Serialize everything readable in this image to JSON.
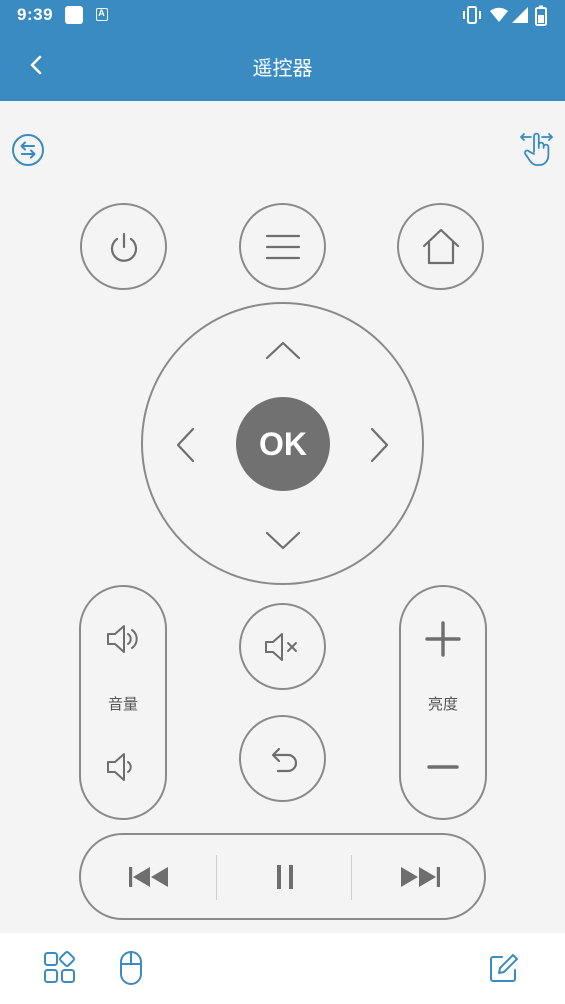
{
  "status_bar": {
    "time": "9:39",
    "notif_icon_letter": "A"
  },
  "app_bar": {
    "title": "遥控器",
    "back_icon": "chevron-left-icon"
  },
  "toolbar": {
    "switch_device_icon": "switch-arrows-icon",
    "gesture_icon": "swipe-hand-icon"
  },
  "buttons": {
    "power_icon": "power-icon",
    "menu_icon": "menu-icon",
    "home_icon": "home-icon",
    "ok_label": "OK",
    "mute_icon": "volume-mute-icon",
    "return_icon": "return-icon"
  },
  "volume": {
    "label": "音量",
    "up_icon": "volume-up-icon",
    "down_icon": "volume-down-icon"
  },
  "brightness": {
    "label": "亮度",
    "up_icon": "plus-icon",
    "down_icon": "minus-icon"
  },
  "media": {
    "prev_icon": "skip-previous-icon",
    "pause_icon": "pause-icon",
    "next_icon": "skip-next-icon"
  },
  "bottom_bar": {
    "apps_icon": "apps-grid-icon",
    "mouse_icon": "mouse-icon",
    "edit_icon": "edit-icon"
  },
  "colors": {
    "primary": "#3a8bc2",
    "ok_fill": "#717171",
    "outline": "#8a8a8a",
    "background": "#f4f4f4"
  }
}
